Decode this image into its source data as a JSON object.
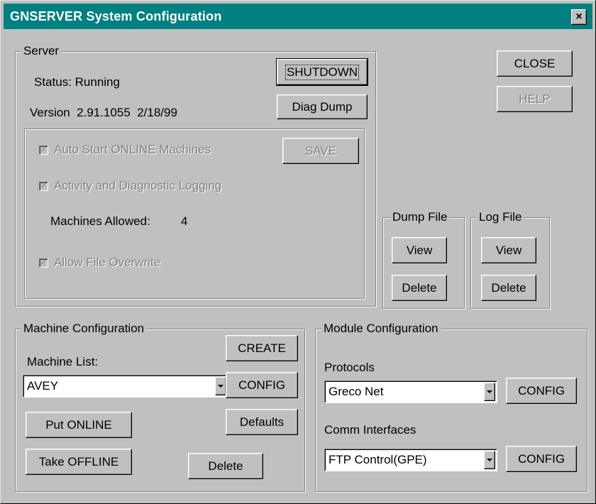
{
  "window": {
    "title": "GNSERVER System Configuration",
    "close_glyph": "×"
  },
  "server": {
    "legend": "Server",
    "status_text": "Status: Running",
    "version_text": "Version  2.91.1055  2/18/99",
    "shutdown_label": "SHUTDOWN",
    "diag_dump_label": "Diag Dump",
    "auto_start_label": "Auto Start ONLINE Machines",
    "auto_start_checked": true,
    "logging_label": "Activity and Diagnostic Logging",
    "logging_checked": true,
    "machines_allowed_label": "Machines Allowed:",
    "machines_allowed_value": "4",
    "overwrite_label": "Allow File Overwrite",
    "overwrite_checked": true,
    "save_label": "SAVE",
    "check_glyph": "✓"
  },
  "dialog_buttons": {
    "close_label": "CLOSE",
    "help_label": "HELP"
  },
  "dump_file": {
    "legend": "Dump File",
    "view_label": "View",
    "delete_label": "Delete"
  },
  "log_file": {
    "legend": "Log File",
    "view_label": "View",
    "delete_label": "Delete"
  },
  "machine_config": {
    "legend": "Machine Configuration",
    "list_label": "Machine List:",
    "selected_machine": "AVEY",
    "create_label": "CREATE",
    "config_label": "CONFIG",
    "defaults_label": "Defaults",
    "put_online_label": "Put ONLINE",
    "take_offline_label": "Take OFFLINE",
    "delete_label": "Delete"
  },
  "module_config": {
    "legend": "Module Configuration",
    "protocols_label": "Protocols",
    "protocol_selected": "Greco Net",
    "protocol_config_label": "CONFIG",
    "comm_label": "Comm Interfaces",
    "comm_selected": "FTP Control(GPE)",
    "comm_config_label": "CONFIG"
  }
}
